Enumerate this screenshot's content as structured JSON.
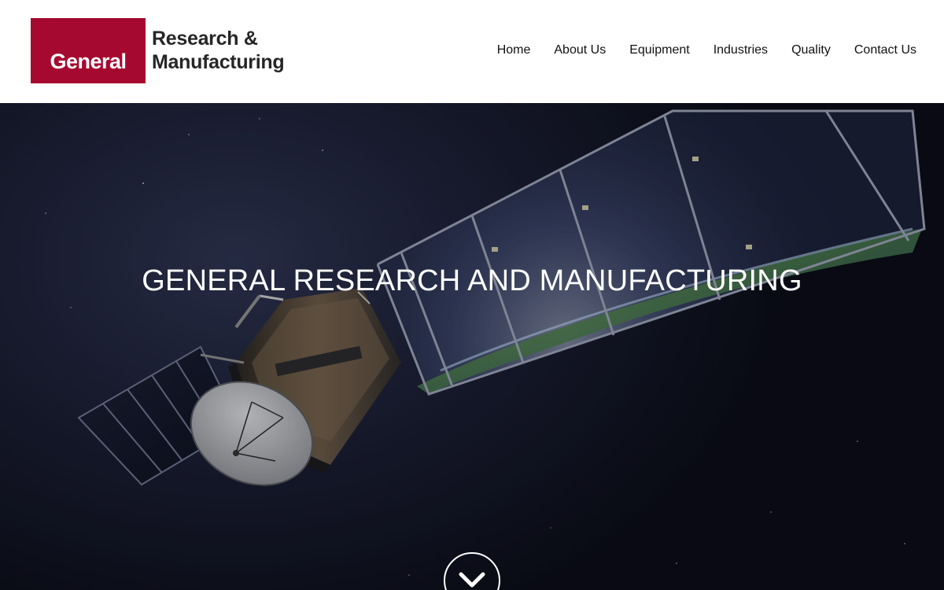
{
  "header": {
    "logo": {
      "box_text": "General",
      "line1": "Research &",
      "line2": "Manufacturing",
      "brand_color": "#a6092f"
    },
    "nav": [
      {
        "label": "Home"
      },
      {
        "label": "About Us"
      },
      {
        "label": "Equipment"
      },
      {
        "label": "Industries"
      },
      {
        "label": "Quality"
      },
      {
        "label": "Contact Us"
      }
    ]
  },
  "hero": {
    "title": "GENERAL RESEARCH AND MANUFACTURING",
    "background_image": "satellite-orbiting-earth",
    "scroll_icon": "chevron-down-icon"
  }
}
